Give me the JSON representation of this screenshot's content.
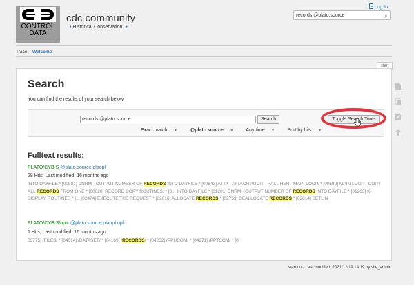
{
  "header": {
    "logo_line1": "CONTROL",
    "logo_line2": "DATA",
    "site_title": "cdc community",
    "tagline": "Historical Conservation",
    "login_label": "Log In",
    "search_value": "records @plato.source",
    "search_icon": "magnifier-icon"
  },
  "trace": {
    "label": "Trace:",
    "crumb": "Welcome"
  },
  "tab_label": "start",
  "search": {
    "title": "Search",
    "intro": "You can find the results of your search below.",
    "query": "records @plato.source",
    "button": "Search",
    "toggle_button": "Toggle Search Tools",
    "filters": [
      "Exact match",
      "@plato.source",
      "Any time",
      "Sort by hits"
    ]
  },
  "results": {
    "heading": "Fulltext results:",
    "items": [
      {
        "page": "PLATO/CYBIS",
        "link": "@plato.source:plaopl",
        "meta": "28 Hits, Last modified: 16 months ago",
        "snippet_html_segments": [
          [
            "INTO DAYFILE * [00581] DNRM - OUTPUT NUMBER OF ",
            false
          ],
          [
            "RECORDS",
            true
          ],
          [
            " INTO DAYFILE * [00643] ATTA - ATTACH AUDIT TRAI... HER - MAIN LOOP. * [00580] MAIN LOOP - COPY ALL ",
            false
          ],
          [
            "RECORDS",
            true
          ],
          [
            " FROM ONE * [00620] RECORD COPY ROUTINES. * [0... INTO DAYFILE * [01201] DNRM - OUTPUT NUMBER OF ",
            false
          ],
          [
            "RECORDS",
            true
          ],
          [
            " INTO DAYFILE * [01263] K-DISPLAY ROUTINES * [... [02474] EXECUTE THE REQUEST * [02616] ALLOCATE ",
            false
          ],
          [
            "RECORDS",
            true
          ],
          [
            " * [02753] DEALLOCATE ",
            false
          ],
          [
            "RECORDS",
            true
          ],
          [
            " * [02814] SETLIN",
            false
          ]
        ]
      },
      {
        "page": "PLATO/CYBIS/oplc",
        "link": "@plato.source:plaopl:oplc",
        "meta": "1 Hits, Last modified: 16 months ago",
        "snippet_html_segments": [
          [
            "03775] /FILES/ * [04014] /DATASET/ * [04169] /",
            false
          ],
          [
            "RECORDS",
            true
          ],
          [
            "/ * [04252] /PPUCOM/ * [04271] /PPTCOM/ * [0",
            false
          ]
        ]
      }
    ]
  },
  "footer": "start.txt · Last modified: 2021/12/19 14:19 by site_admin",
  "colors": {
    "link": "#2b73b7",
    "page_green": "#008800",
    "highlight": "#ffff66",
    "ring": "#e3323b"
  }
}
